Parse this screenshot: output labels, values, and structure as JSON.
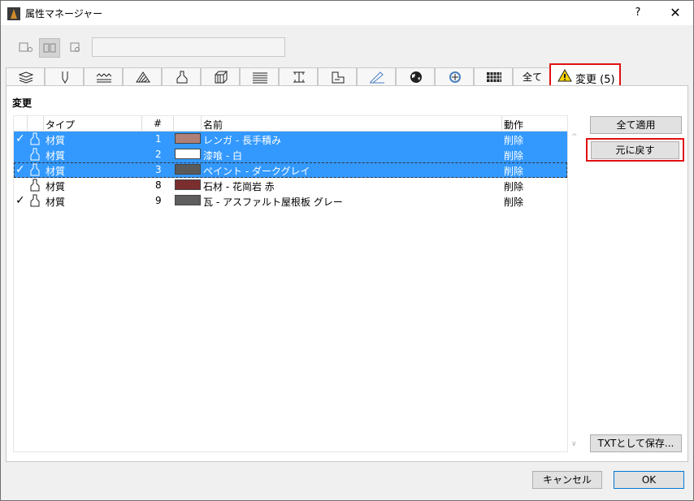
{
  "window": {
    "title": "属性マネージャー",
    "help": "?",
    "close": "✕"
  },
  "toolbar": {
    "view_icons": [
      "list-view-icon",
      "split-view-icon",
      "detail-view-icon"
    ],
    "search_value": ""
  },
  "tabs": [
    {
      "name": "tab-layers",
      "icon": "layers-icon"
    },
    {
      "name": "tab-pens",
      "icon": "pen-icon"
    },
    {
      "name": "tab-line-types",
      "icon": "line-types-icon"
    },
    {
      "name": "tab-fills",
      "icon": "fill-icon"
    },
    {
      "name": "tab-surfaces",
      "icon": "brush-icon"
    },
    {
      "name": "tab-composites",
      "icon": "composite-icon"
    },
    {
      "name": "tab-profiles",
      "icon": "profile-icon"
    },
    {
      "name": "tab-building-materials",
      "icon": "building-material-icon"
    },
    {
      "name": "tab-zones",
      "icon": "zone-icon"
    },
    {
      "name": "tab-markup",
      "icon": "markup-icon"
    },
    {
      "name": "tab-environment",
      "icon": "globe-icon"
    },
    {
      "name": "tab-mep",
      "icon": "mep-icon"
    },
    {
      "name": "tab-grid",
      "icon": "grid-icon"
    }
  ],
  "tab_all_label": "全て",
  "tab_changes_label": "変更 (5)",
  "section_title": "変更",
  "table": {
    "headers": {
      "type": "タイプ",
      "num": "#",
      "name": "名前",
      "action": "動作"
    },
    "rows": [
      {
        "checked": "✓",
        "type": "材質",
        "num": "1",
        "color": "#b08078",
        "name": "レンガ - 長手積み",
        "action": "削除",
        "selected": true
      },
      {
        "checked": "",
        "type": "材質",
        "num": "2",
        "color": "#ffffff",
        "name": "漆喰 - 白",
        "action": "削除",
        "selected": true
      },
      {
        "checked": "✓",
        "type": "材質",
        "num": "3",
        "color": "#5a5a5a",
        "name": "ペイント - ダークグレイ",
        "action": "削除",
        "selected": true
      },
      {
        "checked": "",
        "type": "材質",
        "num": "8",
        "color": "#7a2e2e",
        "name": "石材 - 花崗岩 赤",
        "action": "削除",
        "selected": false
      },
      {
        "checked": "✓",
        "type": "材質",
        "num": "9",
        "color": "#5e5e5e",
        "name": "瓦 - アスファルト屋根板 グレー",
        "action": "削除",
        "selected": false
      }
    ]
  },
  "buttons": {
    "apply_all": "全て適用",
    "revert": "元に戻す",
    "save_txt": "TXTとして保存...",
    "cancel": "キャンセル",
    "ok": "OK"
  },
  "scroll": {
    "up": "^",
    "down": "∨"
  }
}
